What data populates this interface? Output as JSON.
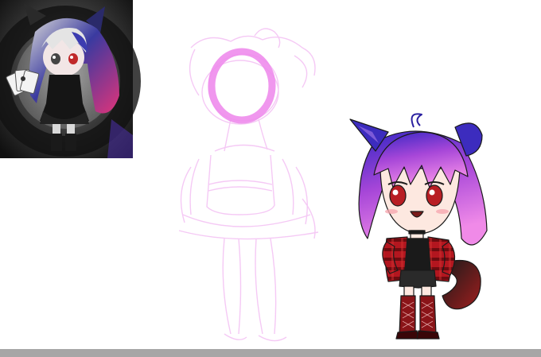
{
  "canvas": {
    "background": "#ffffff",
    "bottom_bar_color": "#a6a6a6"
  },
  "reference_avatar": {
    "description_icon": "character-portrait-icon",
    "bg_dark": "#1e1e1e",
    "bg_mid": "#5a5a5a",
    "glow_color": "#b8b8b8",
    "hair_light": "#d9d9d9",
    "hair_gradient": [
      "#2a2a6a",
      "#d4307a"
    ],
    "eye_color": "#c0282a",
    "outfit_color": "#151515"
  },
  "sketch": {
    "stroke_color": "#f3c0f3",
    "halo_color": "#ee8cec"
  },
  "character": {
    "hair_gradient": [
      "#3a2cc8",
      "#b046d8",
      "#f089e8"
    ],
    "eye_color": "#b81e24",
    "skin_color": "#fde8e0",
    "jacket_color": "#b0161e",
    "jacket_stripe": "#6a0a0e",
    "shirt_color": "#1a1a1a",
    "boot_color": "#8a1418",
    "tail_gradient": [
      "#1a1a1a",
      "#9a1c1c"
    ]
  }
}
